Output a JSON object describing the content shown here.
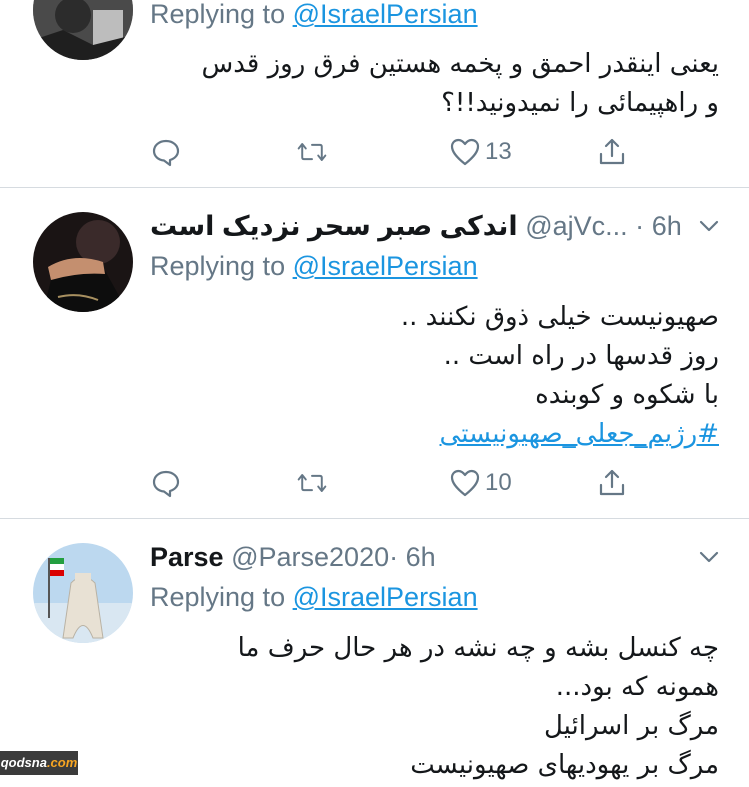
{
  "tweets": [
    {
      "reply_prefix": "Replying to",
      "reply_mention": "@IsraelPersian",
      "lines": [
        "یعنی اینقدر احمق و پخمه هستین فرق روز قدس",
        "و راهپیمائی را نمیدونید!!؟"
      ],
      "likes": "13",
      "avatar_icon": "profile-photo-grayscale"
    },
    {
      "name": "اندکی صبر سحر نزدیک است",
      "handle": "@ajVc...",
      "dot": "·",
      "time": "6h",
      "reply_prefix": "Replying to",
      "reply_mention": "@IsraelPersian",
      "lines": [
        "صهیونیست خیلی ذوق نکنند ..",
        "روز قدسها در راه است ..",
        "با شکوه و کوبنده"
      ],
      "hashtag": "#رژیم_جعلی_صهیونیستی",
      "likes": "10",
      "avatar_icon": "hand-on-chest-photo"
    },
    {
      "name": "Parse",
      "handle": "@Parse2020",
      "dot": "·",
      "time": "6h",
      "reply_prefix": "Replying to",
      "reply_mention": "@IsraelPersian",
      "lines": [
        "چه کنسل بشه و چه نشه در هر حال حرف ما",
        "همونه که بود...",
        "مرگ بر اسرائیل",
        "مرگ بر یهودیهای صهیونیست"
      ],
      "avatar_icon": "azadi-tower-photo"
    }
  ],
  "watermark": {
    "brand": "qodsna",
    "tld": ".com"
  },
  "colors": {
    "link": "#1b95e0",
    "muted": "#657786",
    "divider": "#d6dbe0"
  }
}
